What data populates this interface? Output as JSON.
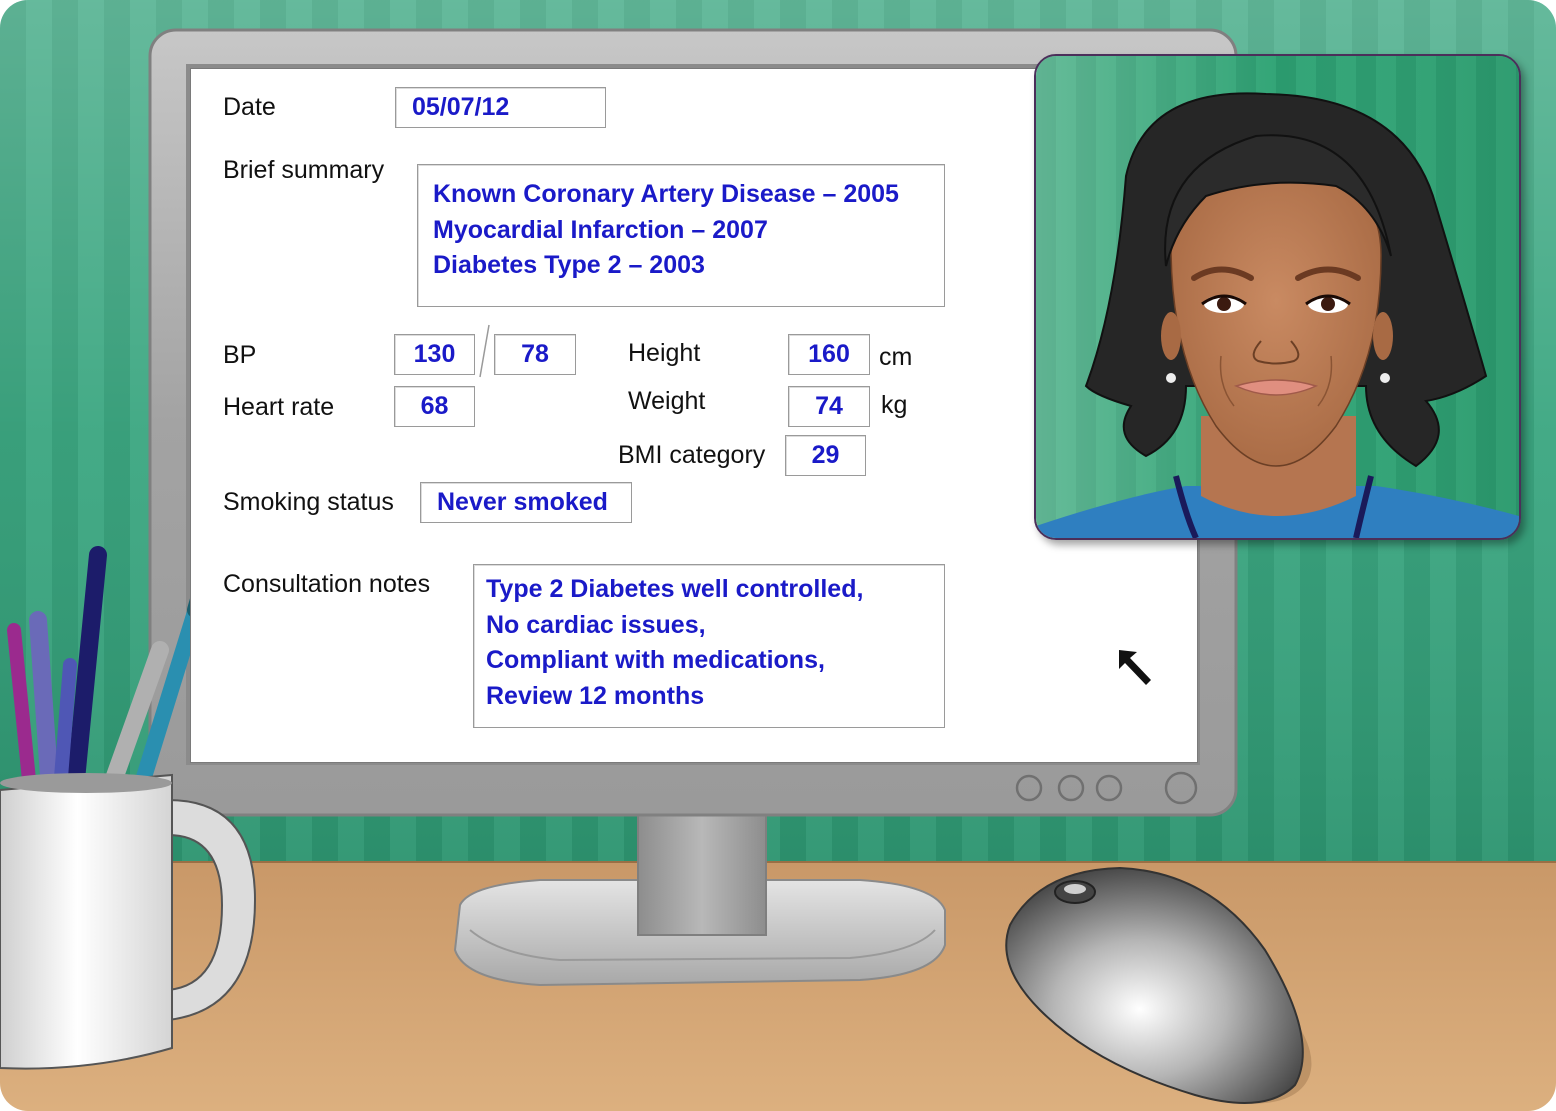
{
  "form": {
    "date": {
      "label": "Date",
      "value": "05/07/12"
    },
    "brief_summary": {
      "label": "Brief summary",
      "lines": [
        "Known Coronary Artery Disease – 2005",
        "Myocardial Infarction – 2007",
        "Diabetes Type 2 – 2003"
      ]
    },
    "bp": {
      "label": "BP",
      "systolic": "130",
      "diastolic": "78"
    },
    "heart_rate": {
      "label": "Heart rate",
      "value": "68"
    },
    "height": {
      "label": "Height",
      "value": "160",
      "unit": "cm"
    },
    "weight": {
      "label": "Weight",
      "value": "74",
      "unit": "kg"
    },
    "bmi": {
      "label": "BMI category",
      "value": "29"
    },
    "smoking": {
      "label": "Smoking status",
      "value": "Never smoked"
    },
    "notes": {
      "label": "Consultation notes",
      "lines": [
        "Type 2 Diabetes well controlled,",
        "No cardiac issues,",
        "Compliant with medications,",
        "Review 12 months"
      ]
    }
  },
  "colors": {
    "wall": "#2f9a74",
    "desk": "#d5a472",
    "field_text": "#1a1ac8",
    "monitor_frame": "#a9a9a9",
    "portrait_bg": "#2b9a6e",
    "shirt": "#2f7fc0"
  },
  "icons": {
    "cursor": "arrow-cursor-icon",
    "monitor_buttons": "monitor-button-icon",
    "mouse": "computer-mouse-icon",
    "mug": "pen-mug-icon",
    "portrait": "patient-portrait"
  }
}
